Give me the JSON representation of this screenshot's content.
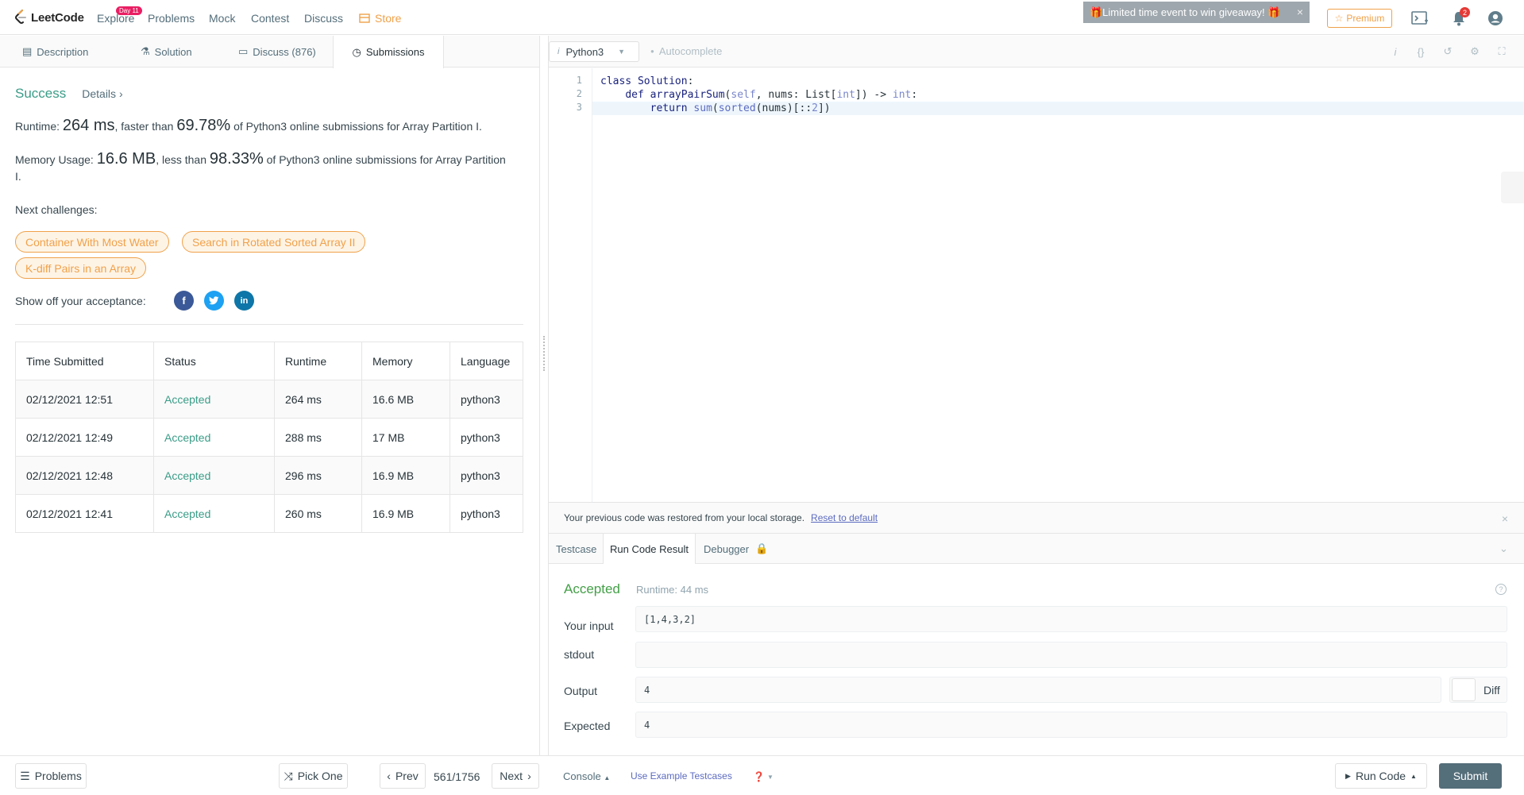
{
  "topnav": {
    "brand": "LeetCode",
    "items": {
      "explore": "Explore",
      "explore_badge": "Day 11",
      "problems": "Problems",
      "mock": "Mock",
      "contest": "Contest",
      "discuss": "Discuss",
      "store": "Store"
    },
    "promo": "🎁Limited time event to win giveaway! 🎁",
    "premium": "Premium",
    "notification_count": "2"
  },
  "left_tabs": {
    "description": "Description",
    "solution": "Solution",
    "discuss": "Discuss (876)",
    "submissions": "Submissions"
  },
  "result_summary": {
    "status": "Success",
    "details": "Details",
    "runtime": {
      "prefix": "Runtime: ",
      "value": "264 ms",
      "mid": ", faster than ",
      "percent": "69.78%",
      "suffix": " of Python3 online submissions for Array Partition I."
    },
    "memory": {
      "prefix": "Memory Usage: ",
      "value": "16.6 MB",
      "mid": ", less than ",
      "percent": "98.33%",
      "suffix": " of Python3 online submissions for Array Partition I."
    },
    "next_label": "Next challenges:",
    "challenges": [
      "Container With Most Water",
      "Search in Rotated Sorted Array II",
      "K-diff Pairs in an Array"
    ],
    "share_label": "Show off your acceptance:"
  },
  "submissions_table": {
    "headers": [
      "Time Submitted",
      "Status",
      "Runtime",
      "Memory",
      "Language"
    ],
    "rows": [
      [
        "02/12/2021 12:51",
        "Accepted",
        "264 ms",
        "16.6 MB",
        "python3"
      ],
      [
        "02/12/2021 12:49",
        "Accepted",
        "288 ms",
        "17 MB",
        "python3"
      ],
      [
        "02/12/2021 12:48",
        "Accepted",
        "296 ms",
        "16.9 MB",
        "python3"
      ],
      [
        "02/12/2021 12:41",
        "Accepted",
        "260 ms",
        "16.9 MB",
        "python3"
      ]
    ]
  },
  "editor": {
    "language": "Python3",
    "autocomplete": "Autocomplete",
    "line_numbers": [
      "1",
      "2",
      "3"
    ]
  },
  "notice": {
    "text": "Your previous code was restored from your local storage.",
    "link": "Reset to default"
  },
  "result_tabs": {
    "testcase": "Testcase",
    "run_result": "Run Code Result",
    "debugger": "Debugger"
  },
  "run_result": {
    "status": "Accepted",
    "runtime": "Runtime: 44 ms",
    "input_label": "Your input",
    "input_value": "[1,4,3,2]",
    "stdout_label": "stdout",
    "stdout_value": "",
    "output_label": "Output",
    "output_value": "4",
    "expected_label": "Expected",
    "expected_value": "4",
    "diff_label": "Diff"
  },
  "bottom": {
    "problems": "Problems",
    "pick_one": "Pick One",
    "prev": "Prev",
    "counter": "561/1756",
    "next": "Next",
    "console": "Console",
    "example_testcases": "Use Example Testcases",
    "run_code": "Run Code",
    "submit": "Submit"
  },
  "colors": {
    "accent_green": "#3a9c87",
    "accepted": "#43a047",
    "orange": "#f0a14a",
    "submit_bg": "#546e7a"
  }
}
